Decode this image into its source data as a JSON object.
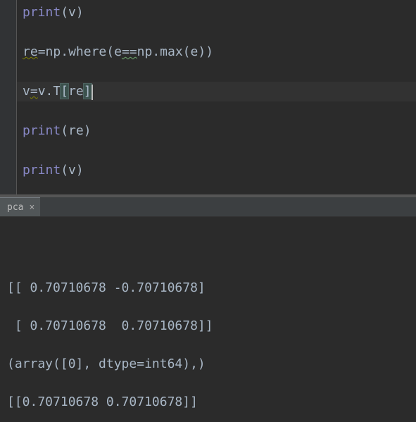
{
  "editor": {
    "lines": {
      "l0_fn": "print",
      "l0_arg": "v",
      "l1_var": "re",
      "l1_np": "np",
      "l1_where": "where",
      "l1_e1": "e",
      "l1_eq": "==",
      "l1_np2": "np",
      "l1_max": "max",
      "l1_e2": "e",
      "l2_v": "v",
      "l2_eq": "=",
      "l2_v2": "v",
      "l2_T": "T",
      "l2_re": "re",
      "l3_fn": "print",
      "l3_arg": "re",
      "l4_fn": "print",
      "l4_arg": "v"
    }
  },
  "tab": {
    "label": "pca",
    "close": "×"
  },
  "console": {
    "header": "",
    "out1": "[[ 0.70710678 -0.70710678]",
    "out2": " [ 0.70710678  0.70710678]]",
    "out3": "(array([0], dtype=int64),)",
    "out4": "[[0.70710678 0.70710678]]"
  },
  "chart_data": null
}
